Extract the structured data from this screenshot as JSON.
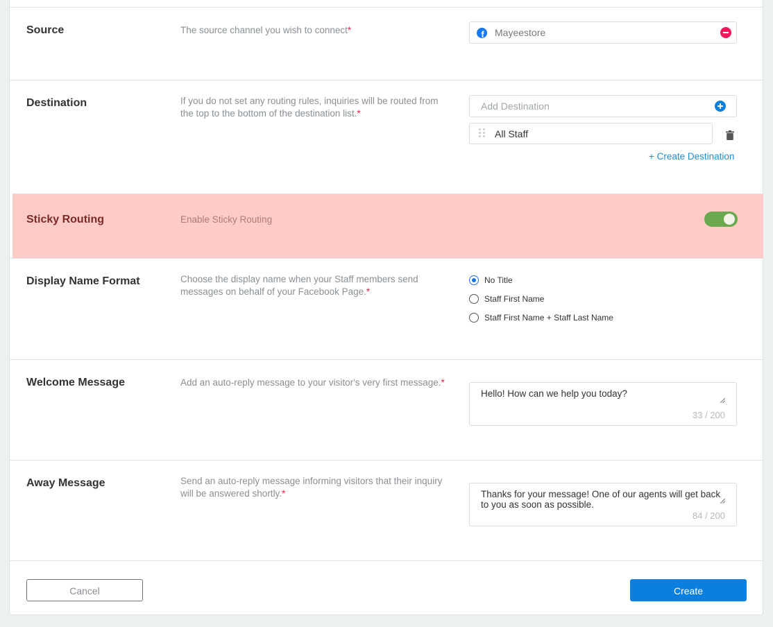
{
  "source": {
    "title": "Source",
    "description": "The source channel you wish to connect",
    "required_mark": "*",
    "channel_name": "Mayeestore",
    "channel_icon": "facebook-icon",
    "remove_icon": "remove-icon"
  },
  "destination": {
    "title": "Destination",
    "description": "If you do not set any routing rules, inquiries will be routed from the top to the bottom of the destination list.",
    "required_mark": "*",
    "add_placeholder": "Add Destination",
    "items": [
      {
        "label": "All Staff"
      }
    ],
    "create_link": "+ Create Destination"
  },
  "sticky_routing": {
    "title": "Sticky Routing",
    "description": "Enable Sticky Routing",
    "enabled": true
  },
  "display_name_format": {
    "title": "Display Name Format",
    "description": "Choose the display name when your Staff members send messages on behalf of your Facebook Page.",
    "required_mark": "*",
    "options": [
      {
        "label": "No Title",
        "selected": true
      },
      {
        "label": "Staff First Name",
        "selected": false
      },
      {
        "label": "Staff First Name + Staff Last Name",
        "selected": false
      }
    ]
  },
  "welcome_message": {
    "title": "Welcome Message",
    "description": "Add an auto-reply message to your visitor's very first message.",
    "required_mark": "*",
    "value": "Hello! How can we help you today?",
    "counter": "33 / 200"
  },
  "away_message": {
    "title": "Away Message",
    "description": "Send an auto-reply message informing visitors that their inquiry will be answered shortly.",
    "required_mark": "*",
    "value": "Thanks for your message! One of our agents will get back to you as soon as possible.",
    "counter": "84 / 200"
  },
  "footer": {
    "cancel_label": "Cancel",
    "create_label": "Create"
  },
  "colors": {
    "accent": "#0b7fe0",
    "highlight": "#fecbc6",
    "toggle_on": "#6aa94e",
    "required": "#e0234e",
    "remove": "#f0185a"
  }
}
